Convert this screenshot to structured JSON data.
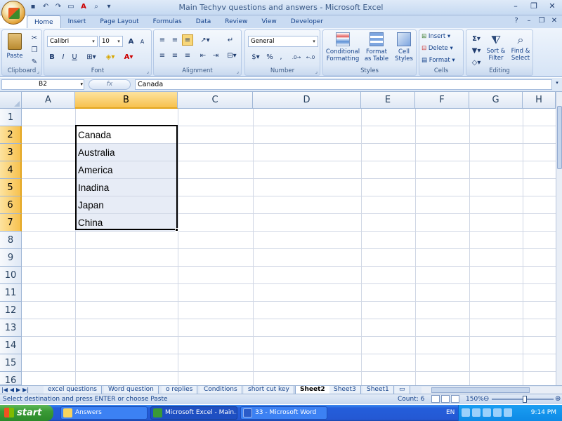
{
  "window": {
    "title": "Main Techyv questions and answers - Microsoft Excel"
  },
  "qat": {
    "save_icon": "save-icon",
    "undo_icon": "undo-icon",
    "redo_icon": "redo-icon"
  },
  "tabs": [
    {
      "label": "Home",
      "active": true
    },
    {
      "label": "Insert",
      "active": false
    },
    {
      "label": "Page Layout",
      "active": false
    },
    {
      "label": "Formulas",
      "active": false
    },
    {
      "label": "Data",
      "active": false
    },
    {
      "label": "Review",
      "active": false
    },
    {
      "label": "View",
      "active": false
    },
    {
      "label": "Developer",
      "active": false
    }
  ],
  "ribbon": {
    "clipboard": {
      "name": "Clipboard",
      "paste_label": "Paste"
    },
    "font": {
      "name": "Font",
      "family": "Calibri",
      "size": "10",
      "bold": "B",
      "italic": "I",
      "underline": "U"
    },
    "alignment": {
      "name": "Alignment"
    },
    "number": {
      "name": "Number",
      "format": "General",
      "currency": "$",
      "percent": "%",
      "comma": ","
    },
    "styles": {
      "name": "Styles",
      "conditional_formatting": "Conditional Formatting",
      "format_as_table": "Format as Table",
      "cell_styles": "Cell Styles"
    },
    "cells": {
      "name": "Cells",
      "insert": "Insert",
      "delete": "Delete",
      "format": "Format"
    },
    "editing": {
      "name": "Editing",
      "sigma": "Σ",
      "sort_filter": "Sort & Filter",
      "find_select": "Find & Select"
    }
  },
  "formula_bar": {
    "name_box": "B2",
    "fx": "fx",
    "value": "Canada"
  },
  "grid": {
    "columns": [
      "A",
      "B",
      "C",
      "D",
      "E",
      "F",
      "G",
      "H"
    ],
    "rows": [
      "1",
      "2",
      "3",
      "4",
      "5",
      "6",
      "7",
      "8",
      "9",
      "10",
      "11",
      "12",
      "13",
      "14",
      "15",
      "16"
    ],
    "selected_column": "B",
    "selected_rows": [
      "2",
      "3",
      "4",
      "5",
      "6",
      "7"
    ],
    "cells": {
      "B2": "Canada",
      "B3": "Australia",
      "B4": "America",
      "B5": "Inadina",
      "B6": "Japan",
      "B7": "China"
    }
  },
  "sheet_tabs": [
    {
      "label": "excel questions",
      "active": false
    },
    {
      "label": "Word question",
      "active": false
    },
    {
      "label": "o replies",
      "active": false
    },
    {
      "label": "Conditions",
      "active": false
    },
    {
      "label": "short cut key",
      "active": false
    },
    {
      "label": "Sheet2",
      "active": true
    },
    {
      "label": "Sheet3",
      "active": false
    },
    {
      "label": "Sheet1",
      "active": false
    }
  ],
  "status_bar": {
    "message": "Select destination and press ENTER or choose Paste",
    "count": "Count: 6",
    "zoom": "150%"
  },
  "taskbar": {
    "start": "start",
    "tasks": [
      {
        "label": "Answers",
        "active": false
      },
      {
        "label": "Microsoft Excel - Main...",
        "active": true
      },
      {
        "label": "33 - Microsoft Word",
        "active": false
      }
    ],
    "language": "EN",
    "clock": "9:14 PM"
  }
}
